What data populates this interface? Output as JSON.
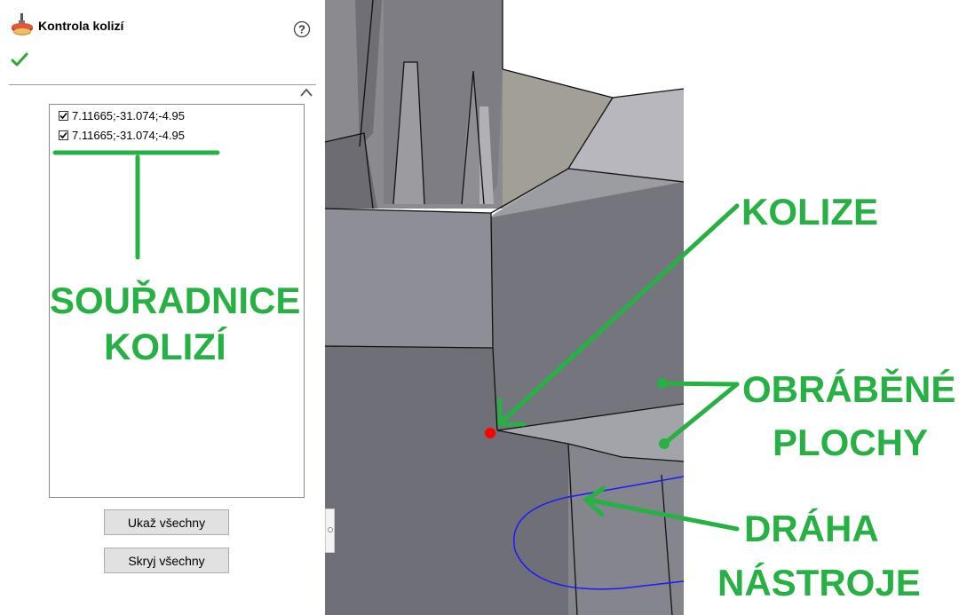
{
  "panel": {
    "title": "Kontrola kolizí",
    "icons": {
      "tool": "milling-tool-icon",
      "help": "help-icon",
      "ok": "checkmark-icon",
      "collapse": "chevron-up-icon"
    },
    "collisions": [
      {
        "checked": true,
        "label": "7.11665;-31.074;-4.95"
      },
      {
        "checked": true,
        "label": "7.11665;-31.074;-4.95"
      }
    ],
    "show_all_label": "Ukaž všechny",
    "hide_all_label": "Skryj všechny"
  },
  "annotations": {
    "coordinates_line1": "SOUŘADNICE",
    "coordinates_line2": "KOLIZÍ",
    "collision": "KOLIZE",
    "machined_line1": "OBRÁBĚNÉ",
    "machined_line2": "PLOCHY",
    "toolpath_line1": "DRÁHA",
    "toolpath_line2": "NÁSTROJE"
  },
  "colors": {
    "annotation_green": "#27b043",
    "collision_point": "#ff0000",
    "toolpath": "#1a1aff",
    "model_gray": "#7f7f89"
  }
}
